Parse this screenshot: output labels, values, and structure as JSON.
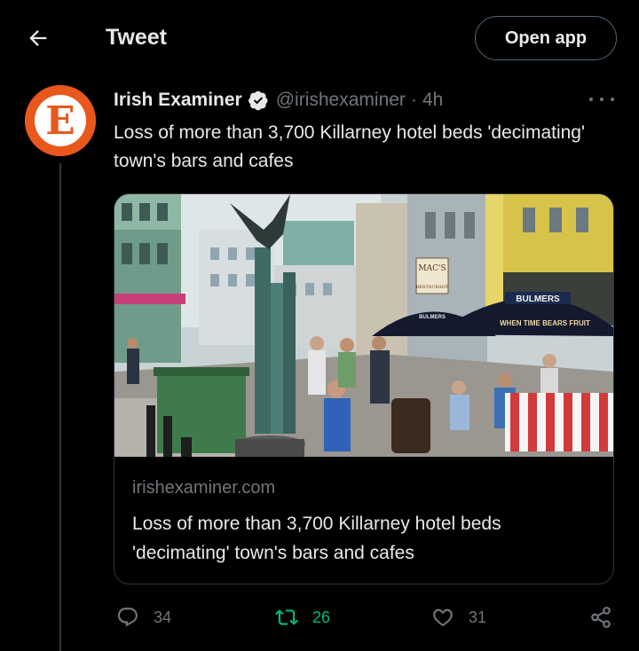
{
  "header": {
    "title": "Tweet",
    "open_app_label": "Open app"
  },
  "tweet": {
    "author_name": "Irish Examiner",
    "handle": "@irishexaminer",
    "separator": "·",
    "time": "4h",
    "text": "Loss of more than 3,700 Killarney hotel beds 'decimating' town's bars and cafes",
    "card": {
      "domain": "irishexaminer.com",
      "title": "Loss of more than 3,700 Killarney hotel beds 'decimating' town's bars and cafes",
      "image_signs": {
        "macs": "MAC'S",
        "macs_sub": "RESTAURANT",
        "bulmers": "BULMERS",
        "bulmers_small": "BULMERS",
        "slogan": "WHEN TIME BEARS FRUIT"
      }
    },
    "actions": {
      "replies": "34",
      "retweets": "26",
      "likes": "31"
    }
  },
  "colors": {
    "background": "#000000",
    "text": "#e7e9ea",
    "secondary_text": "#71767b",
    "border": "#333639",
    "retweet_green": "#00ba7c",
    "verified_badge": "#e7e9ea",
    "avatar_bg": "#e8581c"
  },
  "icons": {
    "back": "arrow-left-icon",
    "verified": "verified-badge-icon",
    "more": "more-horizontal-icon",
    "reply": "reply-icon",
    "retweet": "retweet-icon",
    "like": "heart-icon",
    "share": "share-icon"
  }
}
